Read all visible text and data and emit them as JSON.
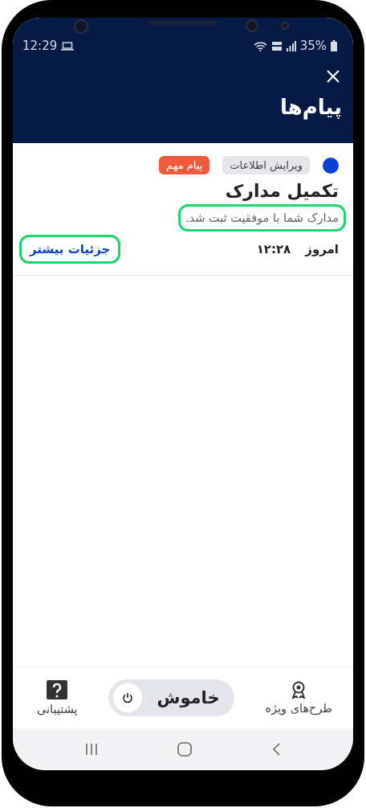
{
  "status_bar": {
    "time": "12:29",
    "battery": "35%"
  },
  "header": {
    "title": "پیام‌ها"
  },
  "message": {
    "unread": true,
    "tags": [
      {
        "label": "ویرایش اطلاعات",
        "color": "#e4e6eb"
      },
      {
        "label": "پیام مهم",
        "color": "#f05a3c"
      }
    ],
    "title": "تکمیل مدارک",
    "body": "مدارک شما با موفقیت ثبت شد.",
    "body_highlighted": true,
    "date": "امروز",
    "time": "۱۲:۲۸",
    "link": "جزئیات بیشتر",
    "link_highlighted": true
  },
  "bottom_nav": [
    {
      "kind": "plans",
      "label": "طرح‌های ویژه"
    },
    {
      "kind": "toggle",
      "label": "خاموش",
      "on": false
    },
    {
      "kind": "support",
      "label": "پشتیبانی"
    }
  ]
}
